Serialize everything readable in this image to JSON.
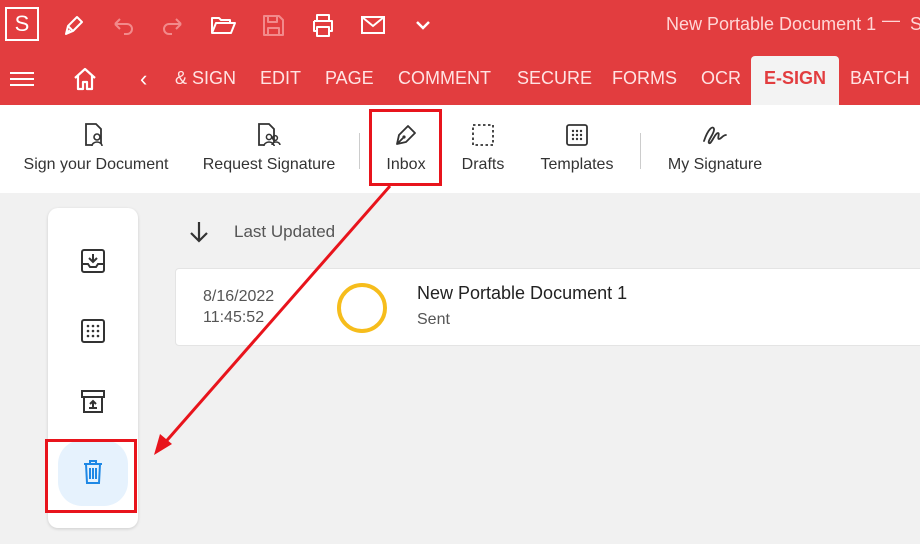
{
  "app": {
    "logo_letter": "S",
    "window_title": "New Portable Document 1",
    "min_glyph": "—",
    "trailing_letter": "S"
  },
  "nav": {
    "back_glyph": "‹",
    "tabs": [
      {
        "label": "& SIGN"
      },
      {
        "label": "EDIT"
      },
      {
        "label": "PAGE"
      },
      {
        "label": "COMMENT"
      },
      {
        "label": "SECURE"
      },
      {
        "label": "FORMS"
      },
      {
        "label": "OCR"
      },
      {
        "label": "E-SIGN",
        "active": true
      },
      {
        "label": "BATCH"
      }
    ]
  },
  "ribbon": {
    "buttons": [
      {
        "label": "Sign your Document",
        "icon": "doc-user-icon"
      },
      {
        "label": "Request Signature",
        "icon": "doc-users-icon"
      },
      {
        "label": "Inbox",
        "icon": "pen-nib-icon"
      },
      {
        "label": "Drafts",
        "icon": "dashed-square-icon"
      },
      {
        "label": "Templates",
        "icon": "dotted-square-icon"
      },
      {
        "label": "My Signature",
        "icon": "signature-icon"
      }
    ]
  },
  "side": {
    "buttons": [
      "inbox-tray-icon",
      "dotted-square-icon",
      "archive-icon",
      "trash-icon"
    ]
  },
  "list": {
    "sort_label": "Last Updated",
    "items": [
      {
        "date": "8/16/2022",
        "time": "11:45:52",
        "title": "New Portable Document 1",
        "status": "Sent"
      }
    ]
  },
  "colors": {
    "brand_red": "#e23d3f",
    "highlight_red": "#e8141c",
    "status_yellow": "#f6bd1c",
    "trash_blue": "#1e88e5"
  }
}
